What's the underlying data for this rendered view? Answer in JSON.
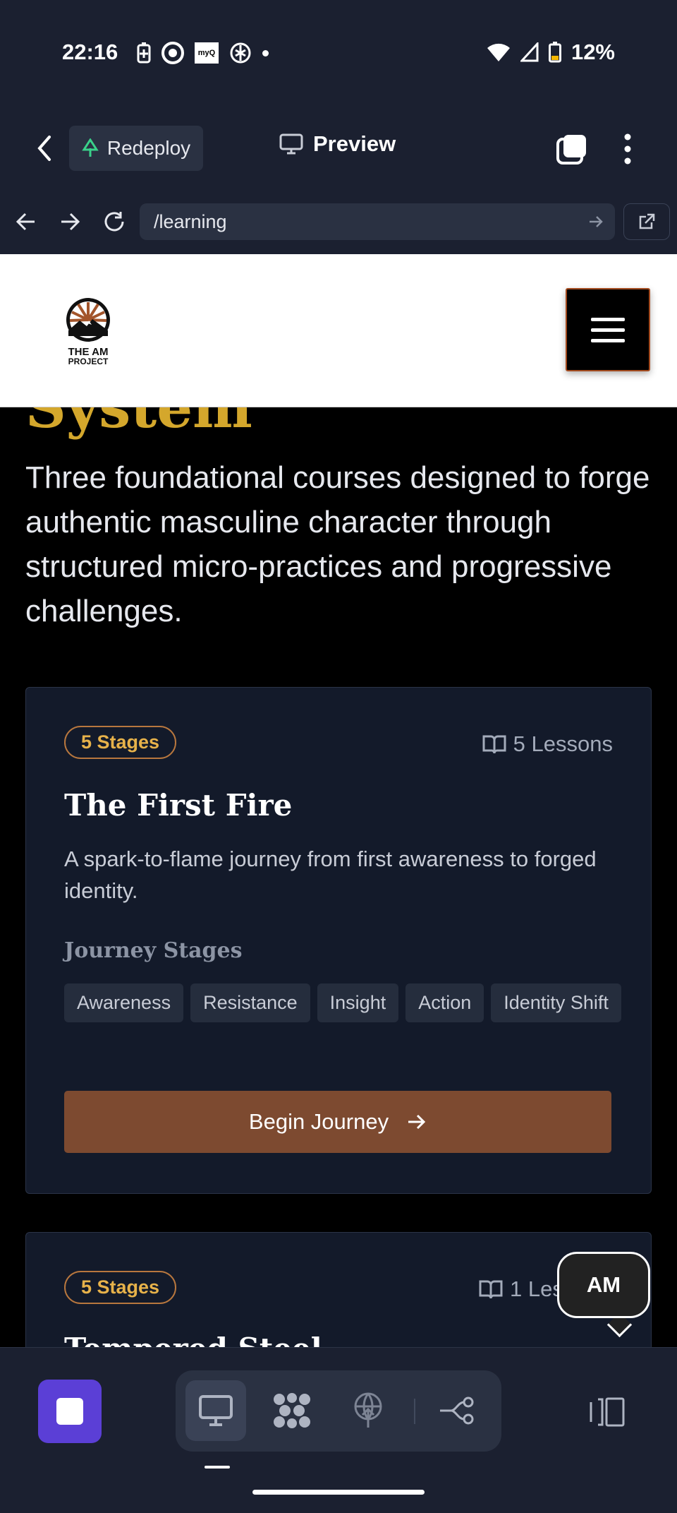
{
  "status_bar": {
    "time": "22:16",
    "battery": "12%",
    "myq_label": "myQ"
  },
  "toolbar": {
    "redeploy_label": "Redeploy",
    "preview_label": "Preview"
  },
  "browser": {
    "url": "/learning"
  },
  "site": {
    "logo_line1": "THE AM",
    "logo_line2": "PROJECT",
    "hero_title_partial": "System",
    "hero_description": "Three foundational courses designed to forge authentic masculine character through structured micro-practices and progressive challenges.",
    "courses": [
      {
        "badge": "5 Stages",
        "lessons": "5 Lessons",
        "title": "The First Fire",
        "description": "A spark-to-flame journey from first awareness to forged identity.",
        "stages_heading": "Journey Stages",
        "stages": [
          "Awareness",
          "Resistance",
          "Insight",
          "Action",
          "Identity Shift"
        ],
        "cta": "Begin Journey"
      },
      {
        "badge": "5 Stages",
        "lessons": "1 Les",
        "title": "Tempered Steel"
      }
    ]
  },
  "chat_bubble": {
    "label": "AM"
  },
  "colors": {
    "accent_gold": "#d4a72c",
    "cta_brown": "#7d4a30",
    "stop_purple": "#5b3fd6"
  }
}
